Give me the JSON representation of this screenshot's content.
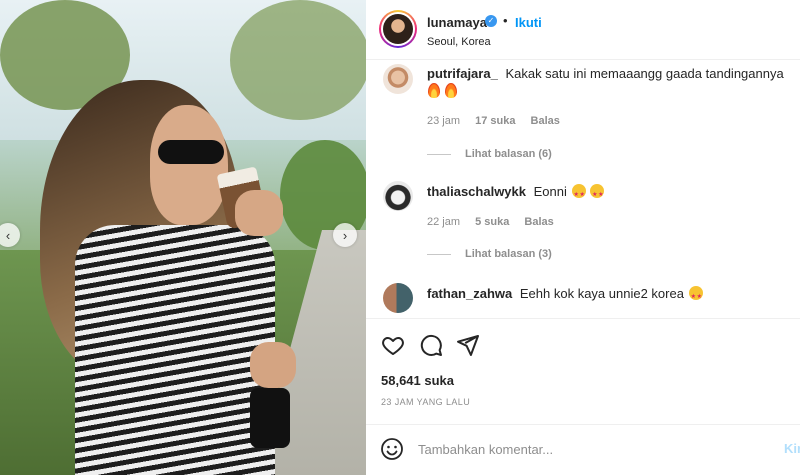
{
  "post": {
    "username": "lunamaya",
    "verified_icon": "verified-badge-icon",
    "separator": "•",
    "follow_label": "Ikuti",
    "location": "Seoul, Korea"
  },
  "comments": [
    {
      "username": "putrifajara_",
      "text": "Kakak satu ini memaaangg gaada tandingannya",
      "emoji": [
        "fire",
        "fire"
      ],
      "time": "23 jam",
      "likes": "17 suka",
      "reply_label": "Balas",
      "view_replies": "Lihat balasan (6)"
    },
    {
      "username": "thaliaschalwykk",
      "text": "Eonni",
      "emoji": [
        "star-struck",
        "star-struck"
      ],
      "time": "22 jam",
      "likes": "5 suka",
      "reply_label": "Balas",
      "view_replies": "Lihat balasan (3)"
    },
    {
      "username": "fathan_zahwa",
      "text": "Eehh kok kaya unnie2 korea",
      "emoji": [
        "star-struck"
      ]
    }
  ],
  "actions": {
    "icons": [
      "heart-icon",
      "comment-icon",
      "share-icon"
    ],
    "likes_count": "58,641 suka",
    "time_ago": "23 JAM YANG LALU"
  },
  "add_comment": {
    "placeholder": "Tambahkan komentar...",
    "post_label": "Kirim"
  },
  "colors": {
    "accent": "#0095f6",
    "text": "#262626",
    "muted": "#8e8e8e",
    "border": "#efefef"
  }
}
